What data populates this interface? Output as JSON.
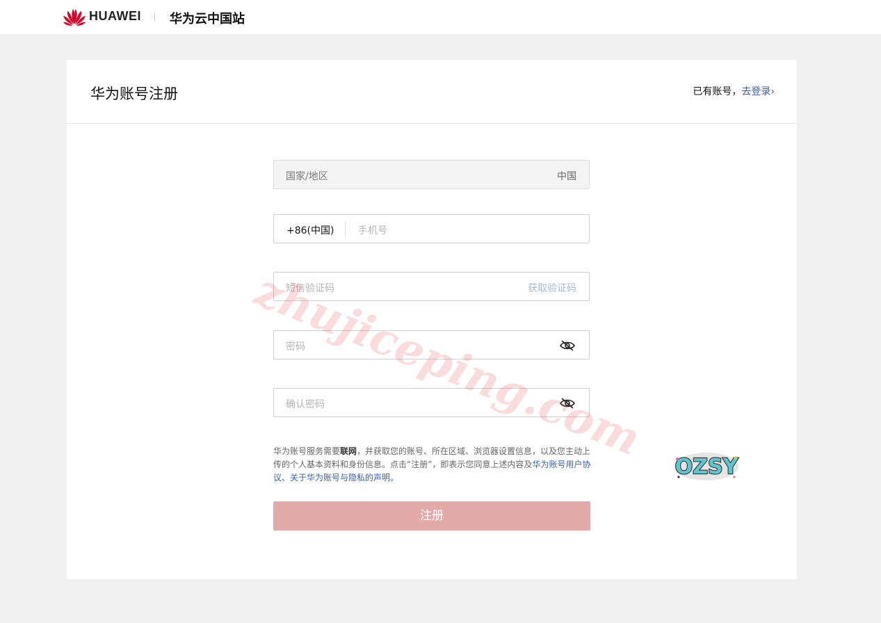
{
  "header": {
    "brand": "HUAWEI",
    "site_name": "华为云中国站",
    "logo_icon": "huawei-petal-logo"
  },
  "card": {
    "title": "华为账号注册",
    "login_prompt": "已有账号，",
    "login_link": "去登录",
    "login_arrow": "›"
  },
  "form": {
    "region_label": "国家/地区",
    "region_value": "中国",
    "country_code": "+86(中国)",
    "phone_placeholder": "手机号",
    "sms_placeholder": "短信验证码",
    "sms_button": "获取验证码",
    "password_placeholder": "密码",
    "confirm_placeholder": "确认密码",
    "eye_icon": "eye-slash-icon"
  },
  "terms": {
    "text1": "华为账号服务需要",
    "bold": "联网",
    "text2": "，并获取您的账号、所在区域、浏览器设置信息，以及您主动上传的个人基本资料和身份信息。点击“注册”，即表示您同意上述内容及",
    "link1": "华为账号用户协议",
    "sep": "、",
    "link2": "关于华为账号与隐私的声明",
    "end": "。"
  },
  "register_button": "注册",
  "badge_text": "OZSY",
  "watermark": "zhujiceping.com",
  "colors": {
    "brand_red": "#cf0a2c",
    "link_blue": "#3b5fa8",
    "button_disabled": "#e2aaa8",
    "page_bg": "#f0f0f0"
  }
}
